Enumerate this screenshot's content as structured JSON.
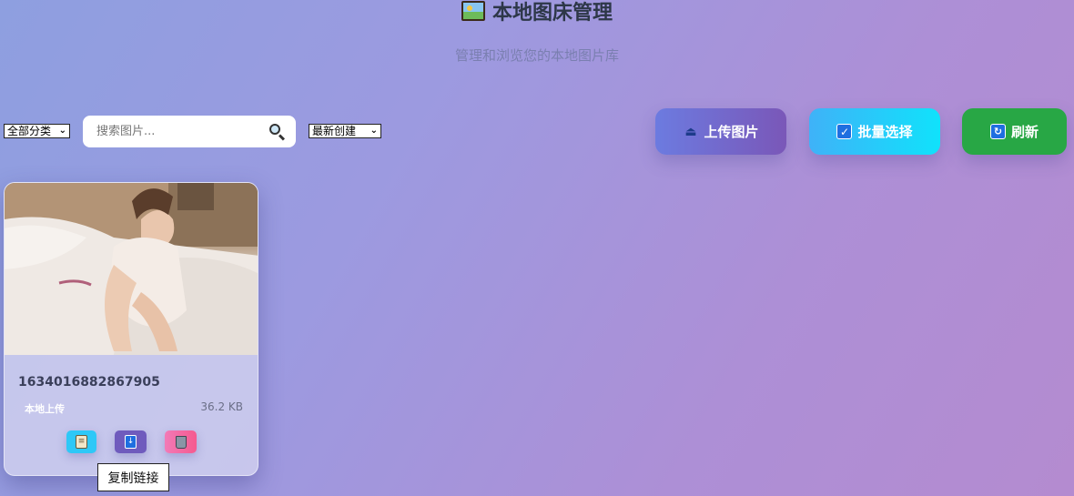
{
  "header": {
    "title": "本地图床管理",
    "title_icon": "framed-picture-icon",
    "subtitle": "管理和浏览您的本地图片库"
  },
  "toolbar": {
    "category_select": {
      "selected": "全部分类"
    },
    "search": {
      "placeholder": "搜索图片...",
      "value": "",
      "icon": "search-icon"
    },
    "sort_select": {
      "selected": "最新创建"
    },
    "buttons": {
      "upload": {
        "label": "上传图片",
        "icon": "upload-tray-icon",
        "color": "#6c7be0"
      },
      "batch_select": {
        "label": "批量选择",
        "icon": "check-box-icon",
        "color": "#3fb2f8"
      },
      "refresh": {
        "label": "刷新",
        "icon": "refresh-icon",
        "color": "#28a745"
      }
    }
  },
  "images": [
    {
      "name": "1634016882867905",
      "source_tag": "本地上传",
      "size": "36.2 KB",
      "actions": {
        "copy": {
          "icon": "clipboard-icon",
          "tooltip": "复制链接"
        },
        "download": {
          "icon": "download-arrow-icon"
        },
        "delete": {
          "icon": "trash-icon"
        }
      }
    }
  ]
}
